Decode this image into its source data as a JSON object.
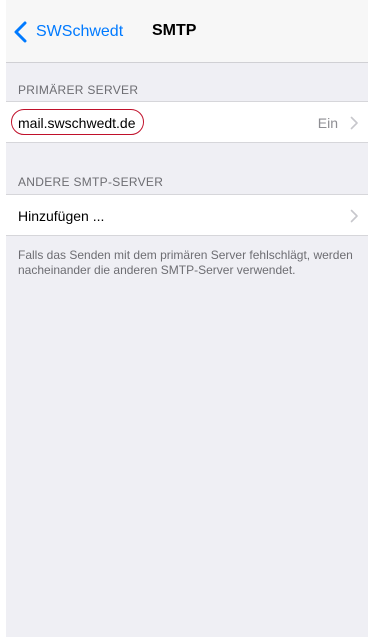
{
  "nav": {
    "back_label": "SWSchwedt",
    "title": "SMTP"
  },
  "primary_section": {
    "header": "PRIMÄRER SERVER",
    "server_name": "mail.swschwedt.de",
    "server_status": "Ein"
  },
  "other_section": {
    "header": "ANDERE SMTP-SERVER",
    "add_label": "Hinzufügen ...",
    "footer": "Falls das Senden mit dem primären Server fehlschlägt, werden nacheinander die anderen SMTP-Server verwendet."
  },
  "colors": {
    "accent": "#007aff",
    "background": "#efeff4",
    "highlight": "#c0102a"
  },
  "icons": {
    "back": "chevron-left-icon",
    "disclosure": "chevron-right-icon"
  }
}
